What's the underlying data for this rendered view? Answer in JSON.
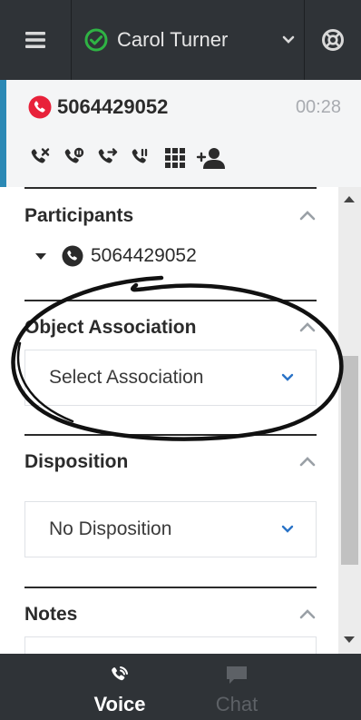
{
  "topbar": {
    "agent_name": "Carol Turner",
    "status": "ready",
    "icons": [
      "hamburger-menu-icon",
      "check-circle-icon",
      "chevron-down-icon",
      "help-lifebuoy-icon"
    ]
  },
  "call": {
    "number": "5064429052",
    "timer": "00:28",
    "actions": [
      "end-call",
      "hold-call",
      "transfer-call",
      "consult-call",
      "keypad",
      "add-participant"
    ]
  },
  "sections": {
    "participants": {
      "title": "Participants",
      "participant_number": "5064429052"
    },
    "object_association": {
      "title": "Object Association",
      "dropdown_value": "Select Association"
    },
    "disposition": {
      "title": "Disposition",
      "dropdown_value": "No Disposition"
    },
    "notes": {
      "title": "Notes"
    }
  },
  "bottom_nav": {
    "tabs": [
      {
        "label": "Voice",
        "active": true
      },
      {
        "label": "Chat",
        "active": false
      }
    ]
  },
  "colors": {
    "topbar_bg": "#2f3337",
    "status_green": "#2fb344",
    "call_red": "#e8213a",
    "accent_blue": "#2b89b5",
    "dropdown_chevron": "#2a73c7"
  }
}
